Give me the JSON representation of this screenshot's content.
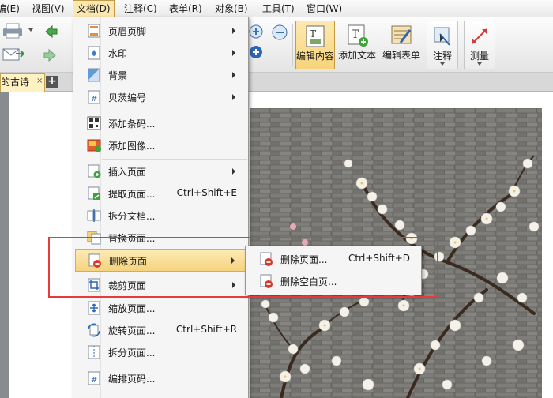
{
  "menubar": {
    "items": [
      {
        "label": "编(E)"
      },
      {
        "label": "视图(V)"
      },
      {
        "label": "文档(D)"
      },
      {
        "label": "注释(C)"
      },
      {
        "label": "表单(R)"
      },
      {
        "label": "对象(B)"
      },
      {
        "label": "工具(T)"
      },
      {
        "label": "窗口(W)"
      }
    ]
  },
  "toolbar": {
    "edit_content": "编辑内容",
    "add_text": "添加文本",
    "edit_form": "编辑表单",
    "annotate": "注释",
    "measure": "测量"
  },
  "tabs": {
    "doc_title": "的古诗",
    "close_glyph": "×",
    "new_tab_glyph": "+"
  },
  "document_menu": {
    "items": [
      {
        "label": "页眉页脚",
        "shortcut": "",
        "submenu": true,
        "icon": "header-footer-icon"
      },
      {
        "label": "水印",
        "shortcut": "",
        "submenu": true,
        "icon": "watermark-icon"
      },
      {
        "label": "背景",
        "shortcut": "",
        "submenu": true,
        "icon": "background-icon"
      },
      {
        "label": "贝茨编号",
        "shortcut": "",
        "submenu": true,
        "icon": "bates-number-icon"
      },
      {
        "label": "添加条码...",
        "shortcut": "",
        "submenu": false,
        "icon": "barcode-icon"
      },
      {
        "label": "添加图像...",
        "shortcut": "",
        "submenu": false,
        "icon": "add-image-icon"
      },
      {
        "label": "插入页面",
        "shortcut": "",
        "submenu": true,
        "icon": "insert-page-icon"
      },
      {
        "label": "提取页面...",
        "shortcut": "Ctrl+Shift+E",
        "submenu": false,
        "icon": "extract-page-icon"
      },
      {
        "label": "拆分文档...",
        "shortcut": "",
        "submenu": false,
        "icon": "split-document-icon"
      },
      {
        "label": "替换页面...",
        "shortcut": "",
        "submenu": false,
        "icon": "replace-page-icon"
      },
      {
        "label": "删除页面",
        "shortcut": "",
        "submenu": true,
        "icon": "delete-page-icon"
      },
      {
        "label": "裁剪页面",
        "shortcut": "",
        "submenu": true,
        "icon": "crop-page-icon"
      },
      {
        "label": "缩放页面...",
        "shortcut": "",
        "submenu": false,
        "icon": "scale-page-icon"
      },
      {
        "label": "旋转页面...",
        "shortcut": "Ctrl+Shift+R",
        "submenu": false,
        "icon": "rotate-page-icon"
      },
      {
        "label": "拆分页面...",
        "shortcut": "",
        "submenu": false,
        "icon": "split-page-icon"
      },
      {
        "label": "编排页码...",
        "shortcut": "",
        "submenu": false,
        "icon": "page-number-icon"
      }
    ]
  },
  "delete_submenu": {
    "items": [
      {
        "label": "删除页面...",
        "shortcut": "Ctrl+Shift+D"
      },
      {
        "label": "删除空白页..."
      }
    ]
  },
  "colors": {
    "highlight": "#f6d37e",
    "annotation_frame": "#e83a3a",
    "active_tab": "#fff2c2"
  }
}
